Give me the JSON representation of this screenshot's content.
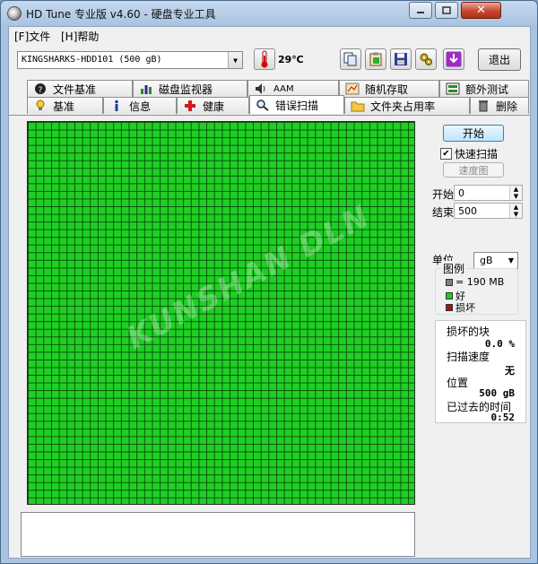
{
  "window": {
    "title": "HD Tune 专业版 v4.60 - 硬盘专业工具"
  },
  "menu": {
    "file": "[F]文件",
    "help": "[H]帮助"
  },
  "toolbar": {
    "drive": "KINGSHARKS-HDD101 (500 gB)",
    "temperature": "29℃",
    "exit_label": "退出"
  },
  "tabs": {
    "top_row": [
      "文件基准",
      "磁盘监视器",
      "AAM",
      "随机存取",
      "额外测试"
    ],
    "bottom_row": [
      "基准",
      "信息",
      "健康",
      "错误扫描",
      "文件夹占用率",
      "删除"
    ],
    "active": "错误扫描"
  },
  "scan": {
    "watermark": "KUNSHAN DLN",
    "start_button": "开始",
    "quick_scan_label": "快速扫描",
    "quick_scan_checked": true,
    "speed_map_label": "速度图",
    "start_label": "开始",
    "start_value": "0",
    "end_label": "结束",
    "end_value": "500",
    "unit_label": "单位",
    "unit_value": "gB",
    "legend": {
      "title": "图例",
      "block_size": "= 190 MB",
      "good": "好",
      "bad": "损坏",
      "colors": {
        "block": "#808080",
        "good": "#22cc22",
        "bad": "#aa1111"
      }
    },
    "stats": {
      "damaged_label": "损坏的块",
      "damaged_value": "0.0 %",
      "speed_label": "扫描速度",
      "speed_value": "无",
      "position_label": "位置",
      "position_value": "500 gB",
      "elapsed_label": "已过去的时间",
      "elapsed_value": "0:52"
    }
  },
  "colors": {
    "grid_fill": "#1fd024",
    "grid_line": "#0a3c0a"
  }
}
